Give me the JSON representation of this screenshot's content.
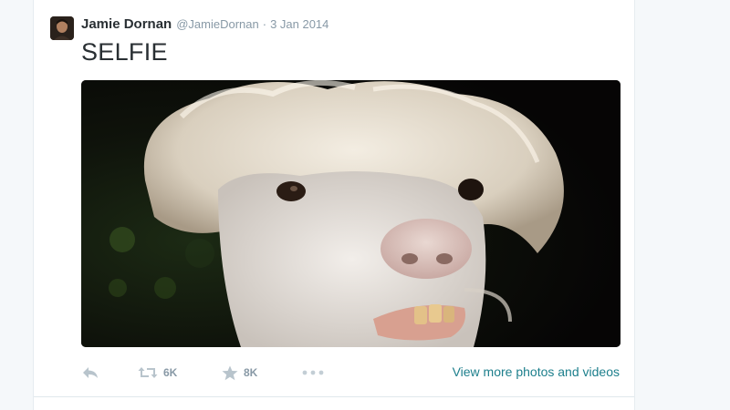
{
  "tweet": {
    "fullname": "Jamie Dornan",
    "username": "@JamieDornan",
    "separator": "·",
    "timestamp": "3 Jan 2014",
    "text": "SELFIE",
    "media": {
      "description_icon": "photo-llama"
    },
    "actions": {
      "reply": {
        "icon": "reply-icon"
      },
      "retweet": {
        "icon": "retweet-icon",
        "count": "6K"
      },
      "like": {
        "icon": "star-icon",
        "count": "8K"
      },
      "more": {
        "icon": "more-dots-icon"
      },
      "view_more_label": "View more photos and videos"
    }
  },
  "colors": {
    "text_primary": "#292f33",
    "text_secondary": "#8899a6",
    "icon_gray": "#aab8c2",
    "link": "#1d7f8c",
    "background": "#f5f8fa"
  }
}
